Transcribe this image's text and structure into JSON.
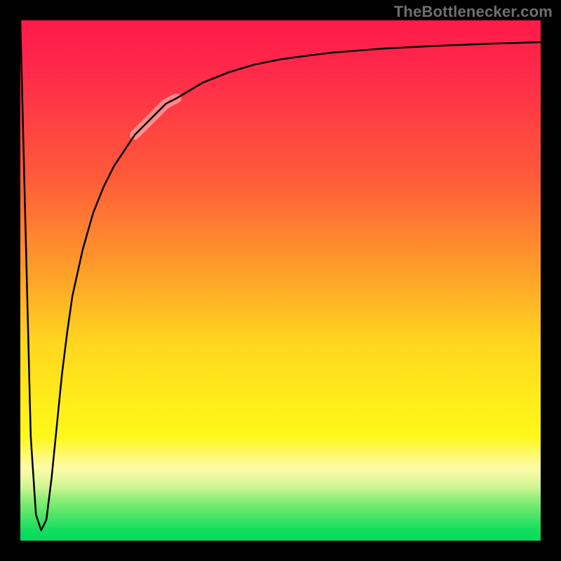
{
  "watermark": "TheBottlenecker.com",
  "colors": {
    "background": "#000000",
    "gradient_top": "#ff1a4a",
    "gradient_mid": "#ffee1a",
    "gradient_bottom": "#05d95b",
    "curve": "#000000",
    "highlight": "rgba(255,200,200,0.55)"
  },
  "chart_data": {
    "type": "line",
    "title": "",
    "xlabel": "",
    "ylabel": "",
    "xlim": [
      0,
      100
    ],
    "ylim": [
      0,
      100
    ],
    "annotations": [
      "TheBottlenecker.com"
    ],
    "highlight_x_range": [
      21,
      30
    ],
    "series": [
      {
        "name": "bottleneck-curve",
        "x": [
          0,
          1,
          2,
          3,
          4,
          5,
          6,
          7,
          8,
          9,
          10,
          12,
          14,
          16,
          18,
          20,
          22,
          24,
          26,
          28,
          30,
          35,
          40,
          45,
          50,
          55,
          60,
          70,
          80,
          90,
          100
        ],
        "y": [
          100,
          60,
          20,
          5,
          2,
          4,
          12,
          22,
          32,
          40,
          47,
          56,
          63,
          68,
          72,
          75,
          78,
          80,
          82,
          84,
          85,
          88,
          90,
          91.5,
          92.5,
          93.2,
          93.8,
          94.6,
          95.1,
          95.5,
          95.8
        ]
      }
    ]
  }
}
